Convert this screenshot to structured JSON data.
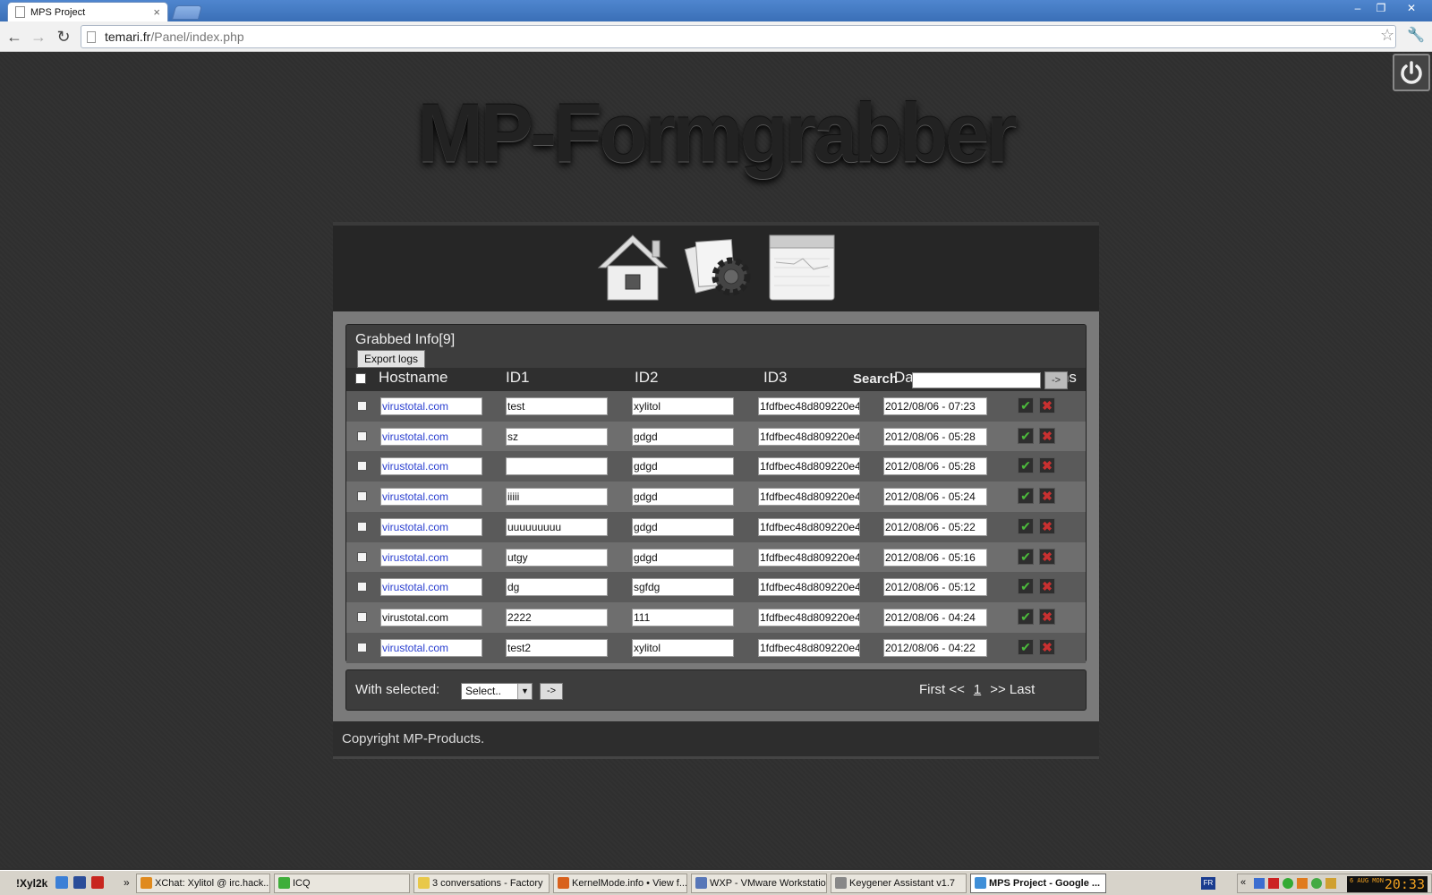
{
  "browser": {
    "tab_title": "MPS Project",
    "tab_close": "×",
    "url_host": "temari.fr",
    "url_path": "/Panel/index.php",
    "window_buttons": [
      "–",
      "❐",
      "✕"
    ]
  },
  "page": {
    "logo_text": "MP-Formgrabber",
    "nav_icons": [
      "home-icon",
      "settings-icon",
      "logs-icon"
    ],
    "grab_title": "Grabbed Info[9]",
    "export_label": "Export logs",
    "columns": {
      "hostname": "Hostname",
      "id1": "ID1",
      "id2": "ID2",
      "id3": "ID3",
      "search": "Search",
      "date": "Da",
      "actions": "tions",
      "search_btn": "->"
    },
    "rows": [
      {
        "host": "virustotal.com",
        "id1": "test",
        "id2": "xylitol",
        "id3": "1fdfbec48d809220e4",
        "date": "2012/08/06 - 07:23",
        "host_link": true
      },
      {
        "host": "virustotal.com",
        "id1": "sz",
        "id2": "gdgd",
        "id3": "1fdfbec48d809220e4",
        "date": "2012/08/06 - 05:28",
        "host_link": true
      },
      {
        "host": "virustotal.com",
        "id1": "",
        "id2": "gdgd",
        "id3": "1fdfbec48d809220e4",
        "date": "2012/08/06 - 05:28",
        "host_link": true
      },
      {
        "host": "virustotal.com",
        "id1": "iiiii",
        "id2": "gdgd",
        "id3": "1fdfbec48d809220e4",
        "date": "2012/08/06 - 05:24",
        "host_link": true
      },
      {
        "host": "virustotal.com",
        "id1": "uuuuuuuuu",
        "id2": "gdgd",
        "id3": "1fdfbec48d809220e4",
        "date": "2012/08/06 - 05:22",
        "host_link": true
      },
      {
        "host": "virustotal.com",
        "id1": "utgy",
        "id2": "gdgd",
        "id3": "1fdfbec48d809220e4",
        "date": "2012/08/06 - 05:16",
        "host_link": true
      },
      {
        "host": "virustotal.com",
        "id1": "dg",
        "id2": "sgfdg",
        "id3": "1fdfbec48d809220e4",
        "date": "2012/08/06 - 05:12",
        "host_link": true
      },
      {
        "host": "virustotal.com",
        "id1": "2222",
        "id2": "111",
        "id3": "1fdfbec48d809220e4",
        "date": "2012/08/06 - 04:24",
        "host_link": false
      },
      {
        "host": "virustotal.com",
        "id1": "test2",
        "id2": "xylitol",
        "id3": "1fdfbec48d809220e4",
        "date": "2012/08/06 - 04:22",
        "host_link": true
      }
    ],
    "row_ok_symbol": "✔",
    "row_del_symbol": "✖",
    "with_selected_label": "With selected:",
    "select_value": "Select..",
    "select_arrow": "▼",
    "go_label": "->",
    "pager": {
      "first": "First <<",
      "page": "1",
      "last": ">> Last"
    },
    "footer": "Copyright MP-Products."
  },
  "taskbar": {
    "start_label": "!Xyl2k",
    "overflow": "»",
    "tasks": [
      {
        "label": "XChat: Xylitol @ irc.hack...",
        "color": "#e08a1e"
      },
      {
        "label": "ICQ",
        "color": "#3fae3a"
      },
      {
        "label": "3 conversations - Factory",
        "color": "#e8c84a"
      },
      {
        "label": "KernelMode.info • View f...",
        "color": "#d8611c"
      },
      {
        "label": "WXP - VMware Workstation",
        "color": "#5877b8"
      },
      {
        "label": "Keygener Assistant v1.7",
        "color": "#888888"
      },
      {
        "label": "MPS Project - Google ...",
        "color": "#3f8fd8",
        "active": true
      }
    ],
    "lang": "FR",
    "tray_overflow": "«",
    "clock_time": "20:33",
    "clock_date": "6 AUG MON"
  },
  "colors": {
    "host_link": "#2a3fd0",
    "ok": "#4cba3c",
    "delete": "#c93030",
    "titlebar": "#3a6fb7"
  }
}
